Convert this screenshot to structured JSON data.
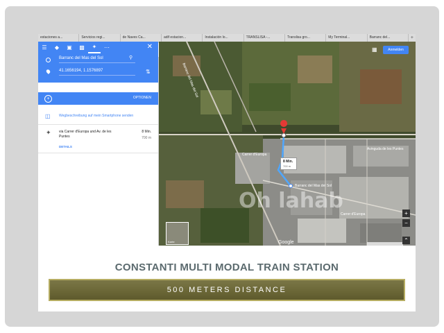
{
  "browser_tabs": [
    "estaciones a...",
    "Servicios regi...",
    "de Naves Ca...",
    "adif estacion...",
    "Instalación lo...",
    "TRANSLISA -...",
    "Translisa gro...",
    "My Terminal...",
    "Barranc del..."
  ],
  "browser_new_tab": "+",
  "directions": {
    "modes": [
      "menu-icon",
      "directions-icon",
      "car-icon",
      "transit-icon",
      "walk-icon",
      "more-icon"
    ],
    "origin": "Barranc del Mas del Sol",
    "destination": "41.1656194, 1.1576897",
    "options_label": "OPTIONEN",
    "send_label": "Wegbeschreibung auf mein Smartphone senden",
    "route": {
      "name": "via Carrer d'Europa und Av. de les Puntes",
      "time": "8 Min.",
      "distance": "700 m",
      "details_label": "DETAILS"
    }
  },
  "map": {
    "signin_label": "Anmelden",
    "time_badge": {
      "time": "8 Min.",
      "distance": "700 m"
    },
    "destination_label": "Barranc del Mas del Sol",
    "google_label": "Google",
    "satellite_thumb_label": "Karte",
    "street_labels": [
      "Barranc del Mas del Sol",
      "Carrer d'Europa",
      "Avinguda de les Puntes",
      "Carrer d'Europa"
    ],
    "watermark": "Oh lahab"
  },
  "caption": {
    "title": "CONSTANTI MULTI MODAL TRAIN STATION",
    "subtitle": "500 METERS DISTANCE"
  },
  "colors": {
    "maps_blue": "#4285f4",
    "banner_olive": "#6a6636",
    "banner_border": "#b6ad62",
    "title_gray": "#5b6a6e"
  }
}
